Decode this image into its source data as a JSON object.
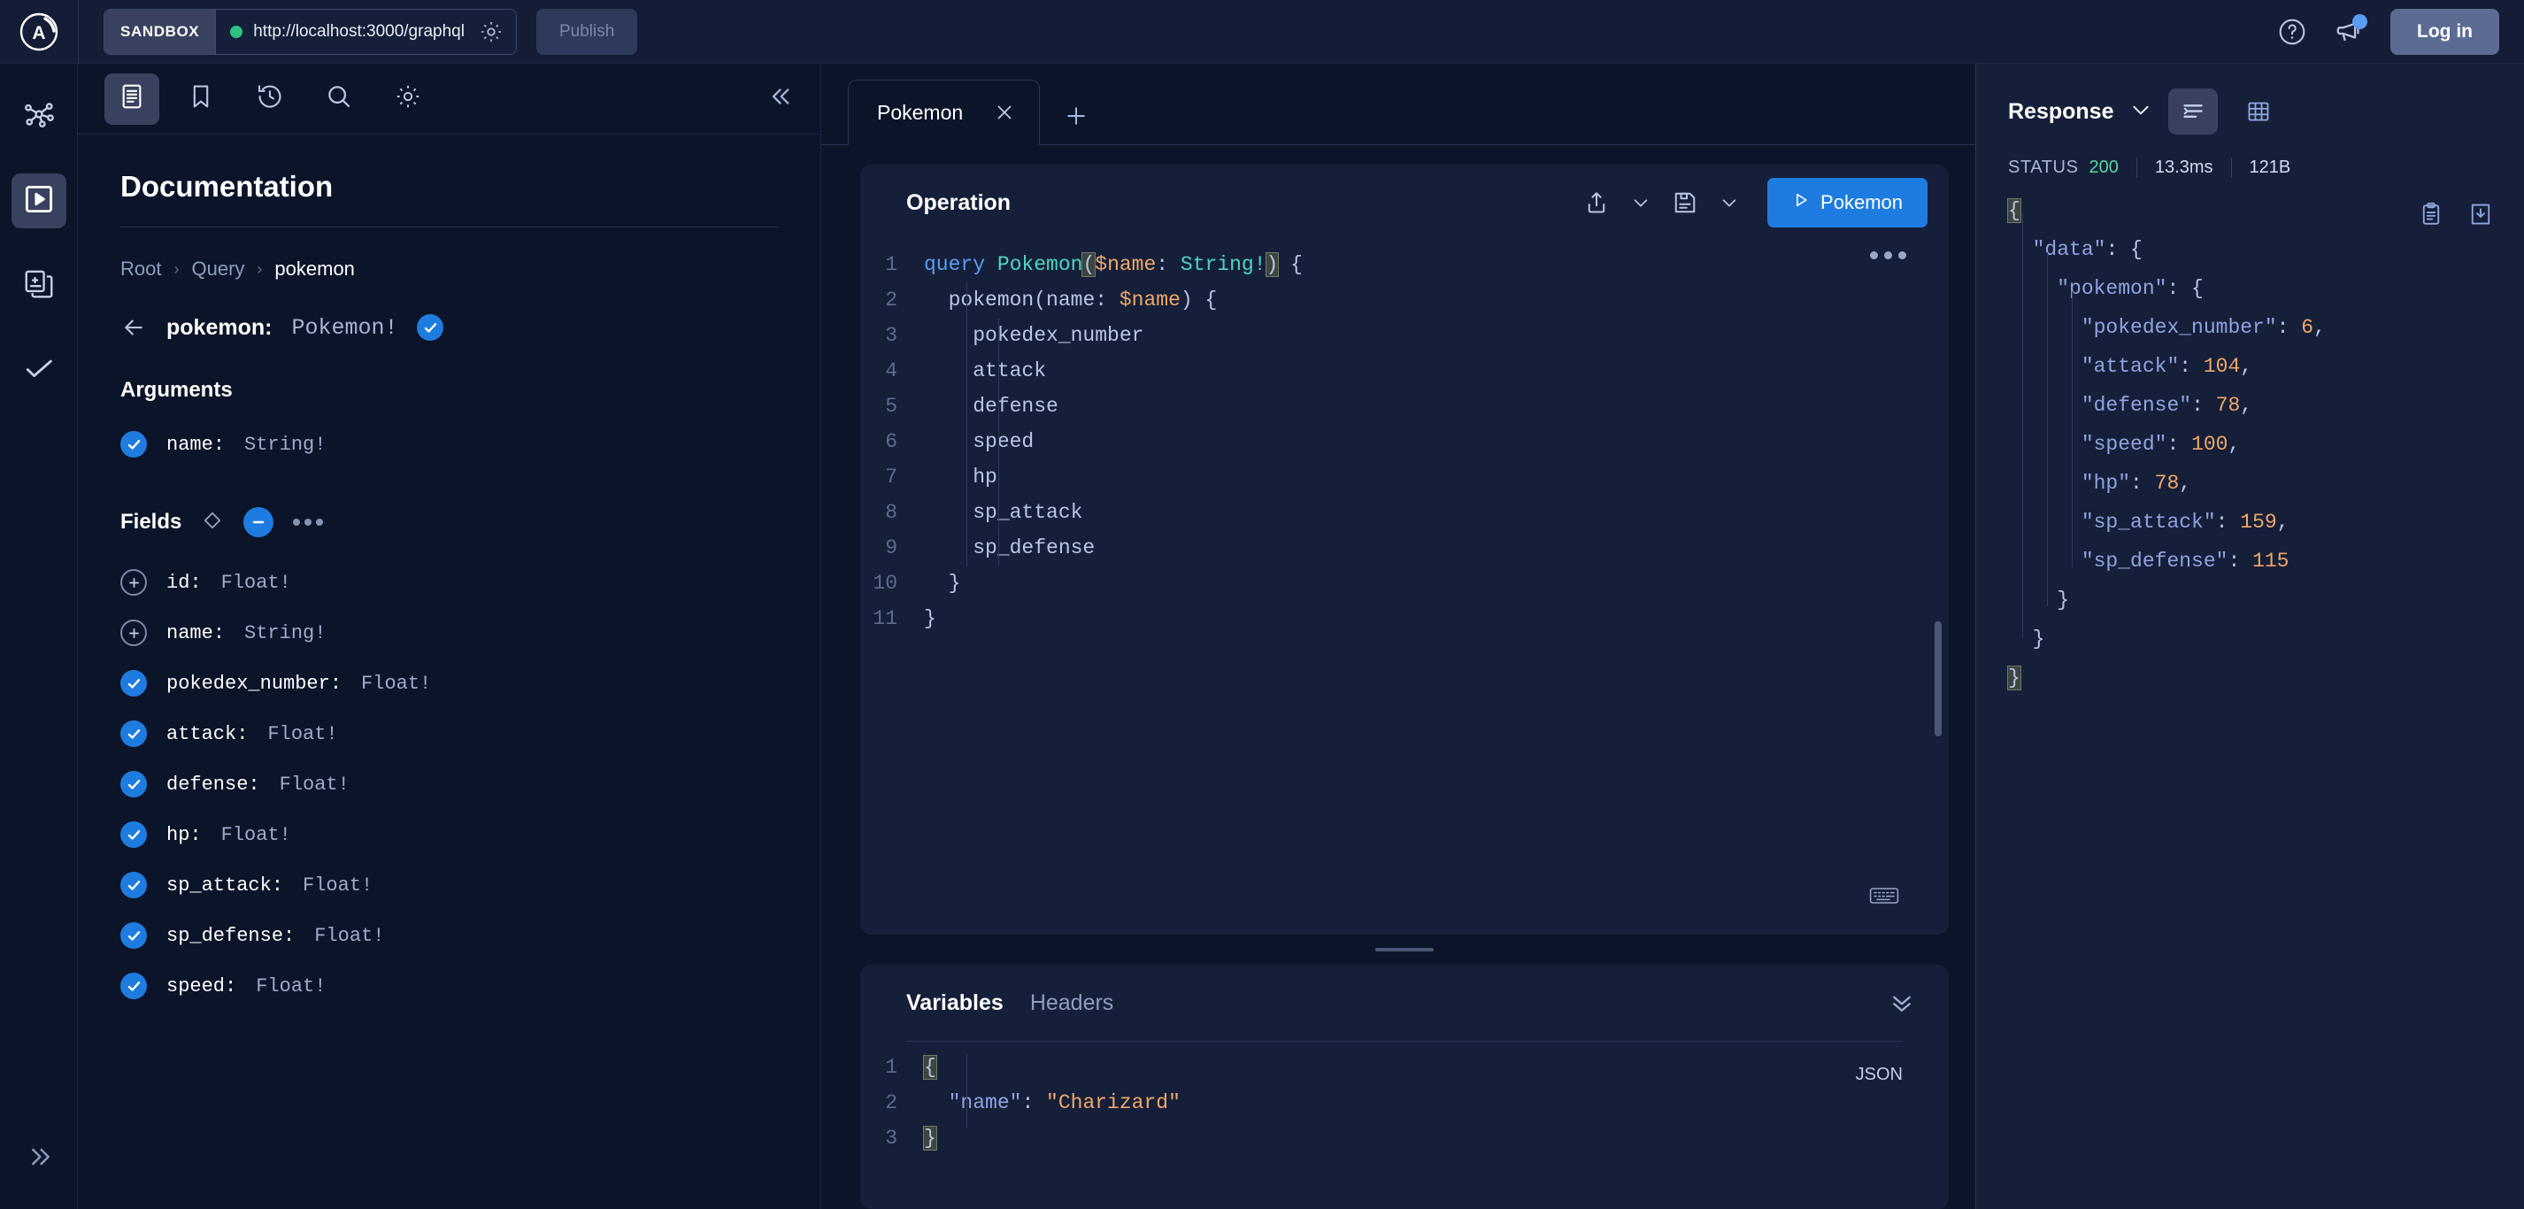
{
  "topbar": {
    "logo_icon": "apollo-logo-icon",
    "sandbox_label": "SANDBOX",
    "endpoint_url": "http://localhost:3000/graphql",
    "endpoint_status": "connected",
    "settings_icon": "gear-icon",
    "publish_label": "Publish",
    "help_icon": "help-circle-icon",
    "announcements_icon": "megaphone-icon",
    "login_label": "Log in",
    "accent_color": "#1e7ce0",
    "status_dot_color": "#2ec27e"
  },
  "rail": {
    "items": [
      {
        "name": "graph-icon",
        "label": "Schema",
        "active": false
      },
      {
        "name": "explorer-play-icon",
        "label": "Explorer",
        "active": true
      },
      {
        "name": "documents-icon",
        "label": "Operations",
        "active": false
      },
      {
        "name": "checkmark-icon",
        "label": "Checks",
        "active": false
      }
    ],
    "expand_icon": "chevron-double-right-icon"
  },
  "docpanel": {
    "tools": [
      {
        "name": "documentation-icon",
        "label": "Documentation",
        "active": true
      },
      {
        "name": "bookmark-icon",
        "label": "Saved",
        "active": false
      },
      {
        "name": "history-icon",
        "label": "History",
        "active": false
      },
      {
        "name": "search-icon",
        "label": "Search",
        "active": false
      },
      {
        "name": "settings-gear-icon",
        "label": "Settings",
        "active": false
      }
    ],
    "collapse_icon": "chevron-double-left-icon",
    "title": "Documentation",
    "breadcrumb": [
      "Root",
      "Query",
      "pokemon"
    ],
    "field_header": {
      "name": "pokemon:",
      "type": "Pokemon!",
      "selected": true
    },
    "arguments_title": "Arguments",
    "arguments": [
      {
        "name": "name:",
        "type": "String!",
        "state": "checked"
      }
    ],
    "fields_title": "Fields",
    "fields_head_icons": [
      "diamond-icon",
      "minus-circle-icon",
      "more-dots-icon"
    ],
    "fields": [
      {
        "name": "id:",
        "type": "Float!",
        "state": "plus"
      },
      {
        "name": "name:",
        "type": "String!",
        "state": "plus"
      },
      {
        "name": "pokedex_number:",
        "type": "Float!",
        "state": "checked"
      },
      {
        "name": "attack:",
        "type": "Float!",
        "state": "checked"
      },
      {
        "name": "defense:",
        "type": "Float!",
        "state": "checked"
      },
      {
        "name": "hp:",
        "type": "Float!",
        "state": "checked"
      },
      {
        "name": "sp_attack:",
        "type": "Float!",
        "state": "checked"
      },
      {
        "name": "sp_defense:",
        "type": "Float!",
        "state": "checked"
      },
      {
        "name": "speed:",
        "type": "Float!",
        "state": "checked"
      }
    ]
  },
  "tabs": {
    "items": [
      {
        "label": "Pokemon",
        "active": true
      }
    ],
    "close_icon": "close-icon",
    "add_icon": "plus-icon"
  },
  "operation": {
    "title": "Operation",
    "share_icon": "share-upload-icon",
    "save_icon": "save-disk-icon",
    "run_label": "Pokemon",
    "run_icon": "play-triangle-icon",
    "more_icon": "more-dots-icon",
    "keyboard_icon": "keyboard-icon",
    "lines": [
      {
        "n": "1",
        "tokens": [
          {
            "t": "query ",
            "c": "k-key"
          },
          {
            "t": "Pokemon",
            "c": "k-opname"
          },
          {
            "t": "(",
            "c": "k-brmatch"
          },
          {
            "t": "$name",
            "c": "k-var"
          },
          {
            "t": ": ",
            "c": "k-punct"
          },
          {
            "t": "String!",
            "c": "k-type"
          },
          {
            "t": ")",
            "c": "k-brmatch"
          },
          {
            "t": " {",
            "c": "k-punct"
          }
        ]
      },
      {
        "n": "2",
        "tokens": [
          {
            "t": "  pokemon",
            "c": "k-field"
          },
          {
            "t": "(name: ",
            "c": "k-punct"
          },
          {
            "t": "$name",
            "c": "k-var"
          },
          {
            "t": ") {",
            "c": "k-punct"
          }
        ]
      },
      {
        "n": "3",
        "tokens": [
          {
            "t": "    pokedex_number",
            "c": "k-field"
          }
        ]
      },
      {
        "n": "4",
        "tokens": [
          {
            "t": "    attack",
            "c": "k-field"
          }
        ]
      },
      {
        "n": "5",
        "tokens": [
          {
            "t": "    defense",
            "c": "k-field"
          }
        ]
      },
      {
        "n": "6",
        "tokens": [
          {
            "t": "    speed",
            "c": "k-field"
          }
        ]
      },
      {
        "n": "7",
        "tokens": [
          {
            "t": "    hp",
            "c": "k-field"
          }
        ]
      },
      {
        "n": "8",
        "tokens": [
          {
            "t": "    sp_attack",
            "c": "k-field"
          }
        ]
      },
      {
        "n": "9",
        "tokens": [
          {
            "t": "    sp_defense",
            "c": "k-field"
          }
        ]
      },
      {
        "n": "10",
        "tokens": [
          {
            "t": "  }",
            "c": "k-punct"
          }
        ]
      },
      {
        "n": "11",
        "tokens": [
          {
            "t": "}",
            "c": "k-punct"
          }
        ]
      }
    ]
  },
  "variables": {
    "tabs": [
      {
        "label": "Variables",
        "active": true
      },
      {
        "label": "Headers",
        "active": false
      }
    ],
    "collapse_icon": "chevron-double-down-icon",
    "format_badge": "JSON",
    "lines": [
      {
        "n": "1",
        "tokens": [
          {
            "t": "{",
            "c": "k-brmatch"
          }
        ]
      },
      {
        "n": "2",
        "tokens": [
          {
            "t": "  ",
            "c": "k-punct"
          },
          {
            "t": "\"name\"",
            "c": "k-prop"
          },
          {
            "t": ": ",
            "c": "k-punct"
          },
          {
            "t": "\"Charizard\"",
            "c": "k-str"
          }
        ]
      },
      {
        "n": "3",
        "tokens": [
          {
            "t": "}",
            "c": "k-brmatch"
          }
        ]
      }
    ]
  },
  "response": {
    "title": "Response",
    "dropdown_icon": "chevron-down-icon",
    "view_buttons": [
      {
        "name": "json-view-icon",
        "active": true
      },
      {
        "name": "table-view-icon",
        "active": false
      }
    ],
    "status_label": "STATUS",
    "status_code": "200",
    "duration": "13.3ms",
    "size": "121B",
    "copy_icon": "clipboard-copy-icon",
    "download_icon": "download-icon",
    "lines": [
      {
        "tokens": [
          {
            "t": "{",
            "c": "k-brmatch"
          }
        ]
      },
      {
        "tokens": [
          {
            "t": "  ",
            "c": "k-punct"
          },
          {
            "t": "\"data\"",
            "c": "k-prop"
          },
          {
            "t": ": {",
            "c": "k-punct"
          }
        ]
      },
      {
        "tokens": [
          {
            "t": "    ",
            "c": "k-punct"
          },
          {
            "t": "\"pokemon\"",
            "c": "k-prop"
          },
          {
            "t": ": {",
            "c": "k-punct"
          }
        ]
      },
      {
        "tokens": [
          {
            "t": "      ",
            "c": "k-punct"
          },
          {
            "t": "\"pokedex_number\"",
            "c": "k-prop"
          },
          {
            "t": ": ",
            "c": "k-punct"
          },
          {
            "t": "6",
            "c": "k-num"
          },
          {
            "t": ",",
            "c": "k-punct"
          }
        ]
      },
      {
        "tokens": [
          {
            "t": "      ",
            "c": "k-punct"
          },
          {
            "t": "\"attack\"",
            "c": "k-prop"
          },
          {
            "t": ": ",
            "c": "k-punct"
          },
          {
            "t": "104",
            "c": "k-num"
          },
          {
            "t": ",",
            "c": "k-punct"
          }
        ]
      },
      {
        "tokens": [
          {
            "t": "      ",
            "c": "k-punct"
          },
          {
            "t": "\"defense\"",
            "c": "k-prop"
          },
          {
            "t": ": ",
            "c": "k-punct"
          },
          {
            "t": "78",
            "c": "k-num"
          },
          {
            "t": ",",
            "c": "k-punct"
          }
        ]
      },
      {
        "tokens": [
          {
            "t": "      ",
            "c": "k-punct"
          },
          {
            "t": "\"speed\"",
            "c": "k-prop"
          },
          {
            "t": ": ",
            "c": "k-punct"
          },
          {
            "t": "100",
            "c": "k-num"
          },
          {
            "t": ",",
            "c": "k-punct"
          }
        ]
      },
      {
        "tokens": [
          {
            "t": "      ",
            "c": "k-punct"
          },
          {
            "t": "\"hp\"",
            "c": "k-prop"
          },
          {
            "t": ": ",
            "c": "k-punct"
          },
          {
            "t": "78",
            "c": "k-num"
          },
          {
            "t": ",",
            "c": "k-punct"
          }
        ]
      },
      {
        "tokens": [
          {
            "t": "      ",
            "c": "k-punct"
          },
          {
            "t": "\"sp_attack\"",
            "c": "k-prop"
          },
          {
            "t": ": ",
            "c": "k-punct"
          },
          {
            "t": "159",
            "c": "k-num"
          },
          {
            "t": ",",
            "c": "k-punct"
          }
        ]
      },
      {
        "tokens": [
          {
            "t": "      ",
            "c": "k-punct"
          },
          {
            "t": "\"sp_defense\"",
            "c": "k-prop"
          },
          {
            "t": ": ",
            "c": "k-punct"
          },
          {
            "t": "115",
            "c": "k-num"
          }
        ]
      },
      {
        "tokens": [
          {
            "t": "    }",
            "c": "k-punct"
          }
        ]
      },
      {
        "tokens": [
          {
            "t": "  }",
            "c": "k-punct"
          }
        ]
      },
      {
        "tokens": [
          {
            "t": "}",
            "c": "k-brmatch"
          }
        ]
      }
    ]
  }
}
